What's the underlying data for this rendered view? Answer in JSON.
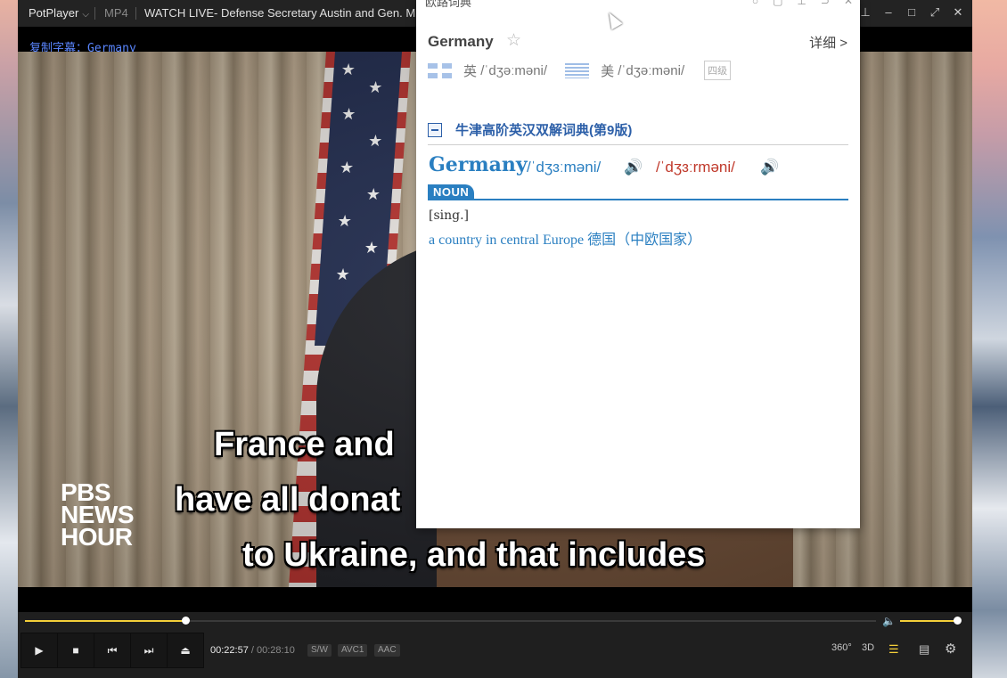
{
  "titlebar": {
    "app_name": "PotPlayer",
    "format": "MP4",
    "title": "WATCH LIVE- Defense Secretary Austin and Gen. Milley"
  },
  "copy_line": "复制字幕：Germany",
  "video": {
    "logo_lines": [
      "PBS",
      "NEWS",
      "HOUR"
    ],
    "subtitles": [
      "France and",
      "have all donat",
      "to Ukraine, and that includes"
    ]
  },
  "controls": {
    "current_time": "00:22:57",
    "separator": "/",
    "duration": "00:28:10",
    "tags": [
      "S/W",
      "AVC1",
      "AAC"
    ],
    "progress": 0.188,
    "volume": 1.0,
    "right_icons": [
      "360°",
      "3D"
    ]
  },
  "dict": {
    "header_name": "欧路词典",
    "word": "Germany",
    "detail_link": "详细 >",
    "uk_label": "英",
    "uk_ipa": "/ˈdʒəːməni/",
    "us_label": "美",
    "us_ipa": "/ˈdʒəːməni/",
    "level": "四级",
    "dictionary_name": "牛津高阶英汉双解词典(第9版)",
    "headword": "Germany",
    "ipa_br": "/ˈdʒɜːməni/",
    "ipa_am": "/ˈdʒɜːrməni/",
    "pos": "NOUN",
    "grammar": "[sing.]",
    "definition": "a country in central Europe 德国（中欧国家）"
  }
}
